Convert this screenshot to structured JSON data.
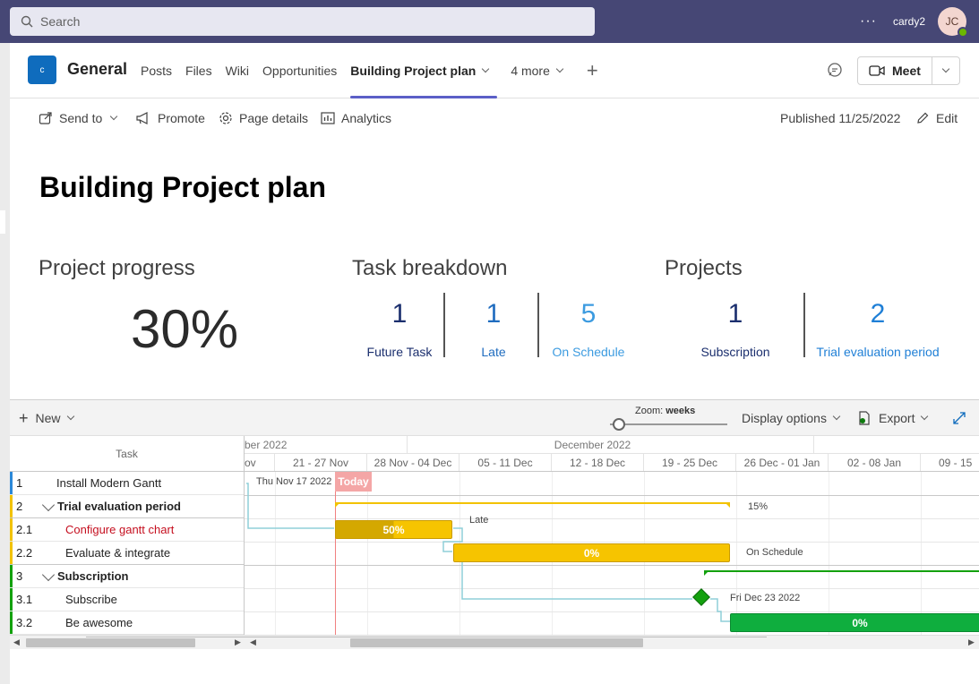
{
  "topbar": {
    "search_placeholder": "Search",
    "more": "···",
    "user_name": "cardy2",
    "avatar_initials": "JC"
  },
  "channel": {
    "team_initial": "c",
    "title": "General",
    "tabs": [
      {
        "label": "Posts"
      },
      {
        "label": "Files"
      },
      {
        "label": "Wiki"
      },
      {
        "label": "Opportunities"
      },
      {
        "label": "Building Project plan"
      },
      {
        "label": "4 more"
      }
    ],
    "meet_label": "Meet"
  },
  "commands": {
    "send_to": "Send to",
    "promote": "Promote",
    "page_details": "Page details",
    "analytics": "Analytics",
    "published": "Published 11/25/2022",
    "edit": "Edit"
  },
  "page": {
    "title": "Building Project plan"
  },
  "progress": {
    "heading": "Project progress",
    "value": "30%"
  },
  "task_breakdown": {
    "heading": "Task breakdown",
    "items": [
      {
        "value": "1",
        "label": "Future Task",
        "color": "#1b2f6e"
      },
      {
        "value": "1",
        "label": "Late",
        "color": "#1f6cbf"
      },
      {
        "value": "5",
        "label": "On Schedule",
        "color": "#3c9be0"
      }
    ]
  },
  "projects": {
    "heading": "Projects",
    "items": [
      {
        "value": "1",
        "label": "Subscription",
        "color": "#1b2f6e"
      },
      {
        "value": "2",
        "label": "Trial evaluation period",
        "color": "#1f7fd6"
      }
    ]
  },
  "gantt_toolbar": {
    "new": "New",
    "zoom_label": "Zoom:",
    "zoom_value": "weeks",
    "display_options": "Display options",
    "export": "Export"
  },
  "gantt": {
    "task_header": "Task",
    "months": [
      "ber 2022",
      "December 2022"
    ],
    "weeks": [
      "ov",
      "21 - 27 Nov",
      "28 Nov - 04 Dec",
      "05 - 11 Dec",
      "12 - 18 Dec",
      "19 - 25 Dec",
      "26 Dec - 01 Jan",
      "02 - 08 Jan",
      "09 - 15"
    ],
    "today_label": "Today",
    "rows": [
      {
        "no": "1",
        "name": "Install Modern Gantt",
        "color": "#2b88d8"
      },
      {
        "no": "2",
        "name": "Trial evaluation period",
        "color": "#f2c200"
      },
      {
        "no": "2.1",
        "name": "Configure gantt chart",
        "color": "#f2c200"
      },
      {
        "no": "2.2",
        "name": "Evaluate & integrate",
        "color": "#f2c200"
      },
      {
        "no": "3",
        "name": "Subscription",
        "color": "#13a10e"
      },
      {
        "no": "3.1",
        "name": "Subscribe",
        "color": "#13a10e"
      },
      {
        "no": "3.2",
        "name": "Be awesome",
        "color": "#13a10e"
      }
    ],
    "labels": {
      "row1_date": "Thu Nov 17 2022",
      "row2_pct": "15%",
      "row3_pct": "50%",
      "row3_status": "Late",
      "row4_pct": "0%",
      "row4_status": "On Schedule",
      "row6_date": "Fri Dec 23 2022",
      "row7_pct": "0%"
    }
  }
}
